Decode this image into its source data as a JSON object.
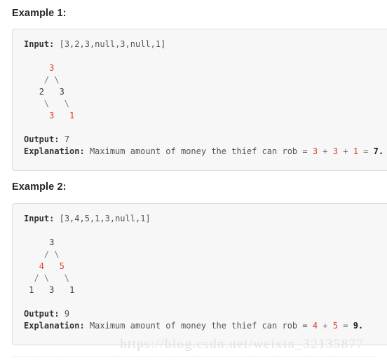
{
  "page": {
    "background_color": "#ffffff",
    "watermark": "https://blog.csdn.net/weixin_32135877",
    "colors": {
      "code_background": "#f7f7f7",
      "code_border": "#dddddd",
      "heading_text": "#262626",
      "body_text": "#555555",
      "label_text": "#333333",
      "highlight_red": "#e03a32",
      "tree_branch": "#6e7c8c",
      "watermark": "#e2e2e2"
    }
  },
  "examples": [
    {
      "heading": "Example 1:",
      "input_label": "Input:",
      "input_value": "[3,2,3,null,3,null,1]",
      "tree": {
        "rows": [
          "     3",
          "    / \\",
          "   2   3",
          "    \\   \\",
          "     3   1"
        ],
        "nodes": [
          {
            "value": "3",
            "highlight": true
          },
          {
            "value": "2",
            "highlight": false
          },
          {
            "value": "3",
            "highlight": false
          },
          {
            "value": "3",
            "highlight": true
          },
          {
            "value": "1",
            "highlight": true
          }
        ]
      },
      "output_label": "Output:",
      "output_value": "7",
      "explanation_label": "Explanation:",
      "explanation_text": "Maximum amount of money the thief can rob = ",
      "explanation_terms": [
        "3",
        "3",
        "1"
      ],
      "explanation_operator": "+",
      "explanation_equals": "=",
      "explanation_result": "7."
    },
    {
      "heading": "Example 2:",
      "input_label": "Input:",
      "input_value": "[3,4,5,1,3,null,1]",
      "tree": {
        "rows": [
          "     3",
          "    / \\",
          "   4   5",
          "  / \\   \\",
          " 1   3   1"
        ],
        "nodes": [
          {
            "value": "3",
            "highlight": false
          },
          {
            "value": "4",
            "highlight": true
          },
          {
            "value": "5",
            "highlight": true
          },
          {
            "value": "1",
            "highlight": false
          },
          {
            "value": "3",
            "highlight": false
          },
          {
            "value": "1",
            "highlight": false
          }
        ]
      },
      "output_label": "Output:",
      "output_value": "9",
      "explanation_label": "Explanation:",
      "explanation_text": "Maximum amount of money the thief can rob = ",
      "explanation_terms": [
        "4",
        "5"
      ],
      "explanation_operator": "+",
      "explanation_equals": "=",
      "explanation_result": "9."
    }
  ]
}
